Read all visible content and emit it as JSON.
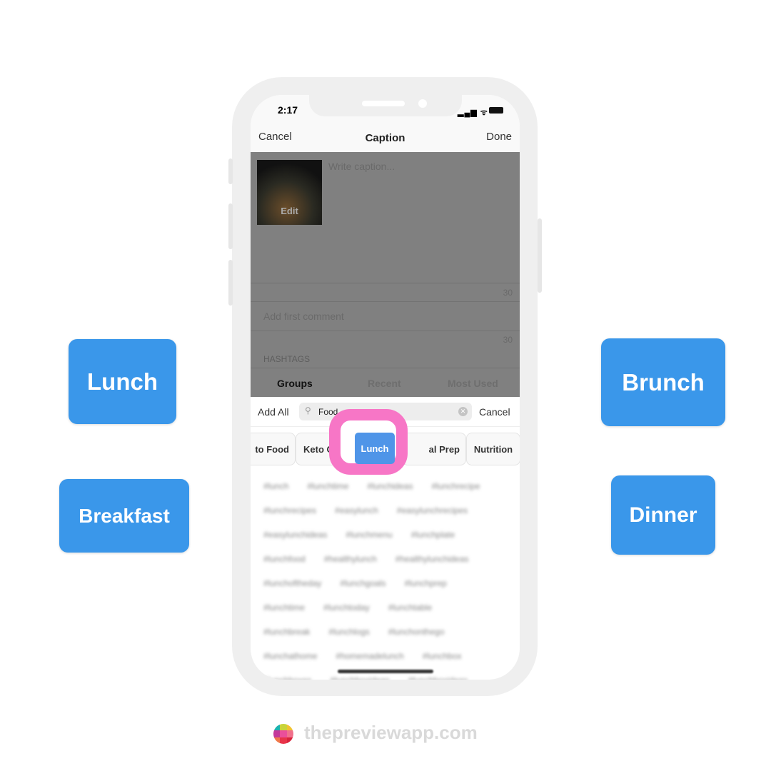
{
  "labels": {
    "lunch": "Lunch",
    "brunch": "Brunch",
    "breakfast": "Breakfast",
    "dinner": "Dinner"
  },
  "status": {
    "time": "2:17"
  },
  "nav": {
    "cancel": "Cancel",
    "title": "Caption",
    "done": "Done"
  },
  "caption": {
    "placeholder": "Write caption...",
    "edit": "Edit",
    "count": "30"
  },
  "comment": {
    "placeholder": "Add first comment",
    "count": "30"
  },
  "hashtags": {
    "header": "HASHTAGS",
    "tabs": [
      "Groups",
      "Recent",
      "Most Used"
    ],
    "active_tab": "Groups"
  },
  "search": {
    "add_all": "Add All",
    "value": "Food",
    "cancel": "Cancel"
  },
  "groups": [
    "to Food",
    "Keto C",
    "Lunch",
    "al Prep",
    "Nutrition"
  ],
  "selected_group": "Lunch",
  "hashtag_rows": [
    [
      "#lunch",
      "#lunchtime",
      "#lunchideas",
      "#lunchrecipe"
    ],
    [
      "#lunchrecipes",
      "#easylunch",
      "#easylunchrecipes"
    ],
    [
      "#easylunchideas",
      "#lunchmenu",
      "#lunchplate"
    ],
    [
      "#lunchfood",
      "#healthylunch",
      "#healthylunchideas"
    ],
    [
      "#lunchoftheday",
      "#lunchgoals",
      "#lunchprep"
    ],
    [
      "#lunchtime",
      "#lunchtoday",
      "#lunchtable"
    ],
    [
      "#lunchbreak",
      "#lunchlogs",
      "#lunchonthego"
    ],
    [
      "#lunchathome",
      "#homemadelunch",
      "#lunchbox"
    ],
    [
      "#lunchboxes",
      "#lunchboxideas",
      "#lunchboxideas"
    ]
  ],
  "footer": {
    "site": "thepreviewapp.com"
  },
  "colors": {
    "tag_blue": "#3a97ea",
    "highlight_pink": "#f776c6",
    "chip_blue": "#4f95e8"
  }
}
